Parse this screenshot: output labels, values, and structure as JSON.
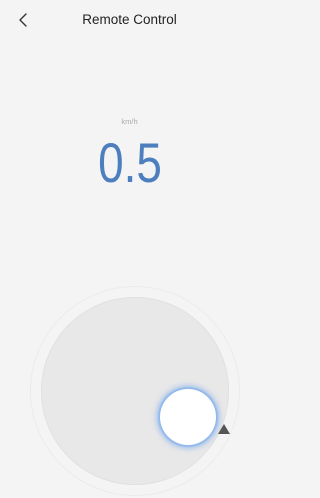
{
  "header": {
    "title": "Remote Control",
    "back_icon": "chevron-left-icon"
  },
  "speed": {
    "unit": "km/h",
    "value": "0.5",
    "color": "#4d7fbf"
  },
  "joystick": {
    "direction_icon": "triangle-up-icon"
  }
}
